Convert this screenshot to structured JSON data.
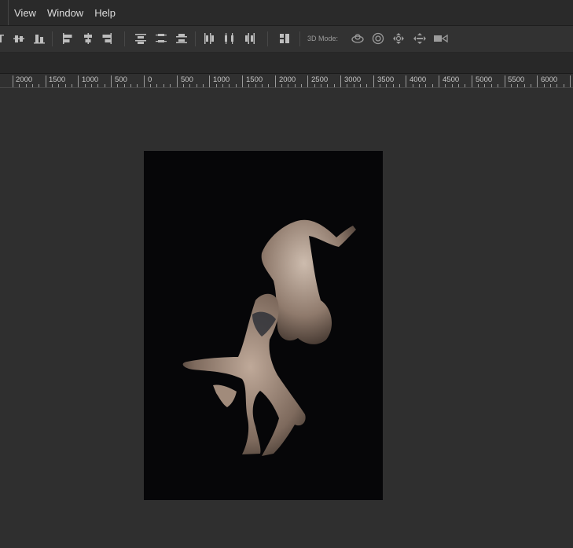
{
  "menu": {
    "items": [
      "View",
      "Window",
      "Help"
    ]
  },
  "options_bar": {
    "mode_3d_label": "3D Mode:",
    "align_icons": [
      "align-top-edges-icon",
      "align-vertical-centers-icon",
      "align-bottom-edges-icon",
      "align-left-edges-icon",
      "align-horizontal-centers-icon",
      "align-right-edges-icon"
    ],
    "distribute_icons": [
      "distribute-top-icon",
      "distribute-vertical-centers-icon",
      "distribute-bottom-icon",
      "distribute-left-icon",
      "distribute-horizontal-centers-icon",
      "distribute-right-icon"
    ],
    "mode_3d_icons": [
      "rotate-3d-icon",
      "roll-3d-icon",
      "pan-3d-icon",
      "slide-3d-icon",
      "scale-3d-icon"
    ]
  },
  "ruler": {
    "labels": [
      "2000",
      "1500",
      "1000",
      "500",
      "0",
      "500",
      "1000",
      "1500",
      "2000",
      "2500",
      "3000",
      "3500",
      "4000",
      "4500",
      "5000",
      "5500",
      "6000"
    ]
  },
  "colors": {
    "app_background": "#2f2f2f",
    "menubar": "#2a2a2a",
    "document_background": "#060608"
  }
}
